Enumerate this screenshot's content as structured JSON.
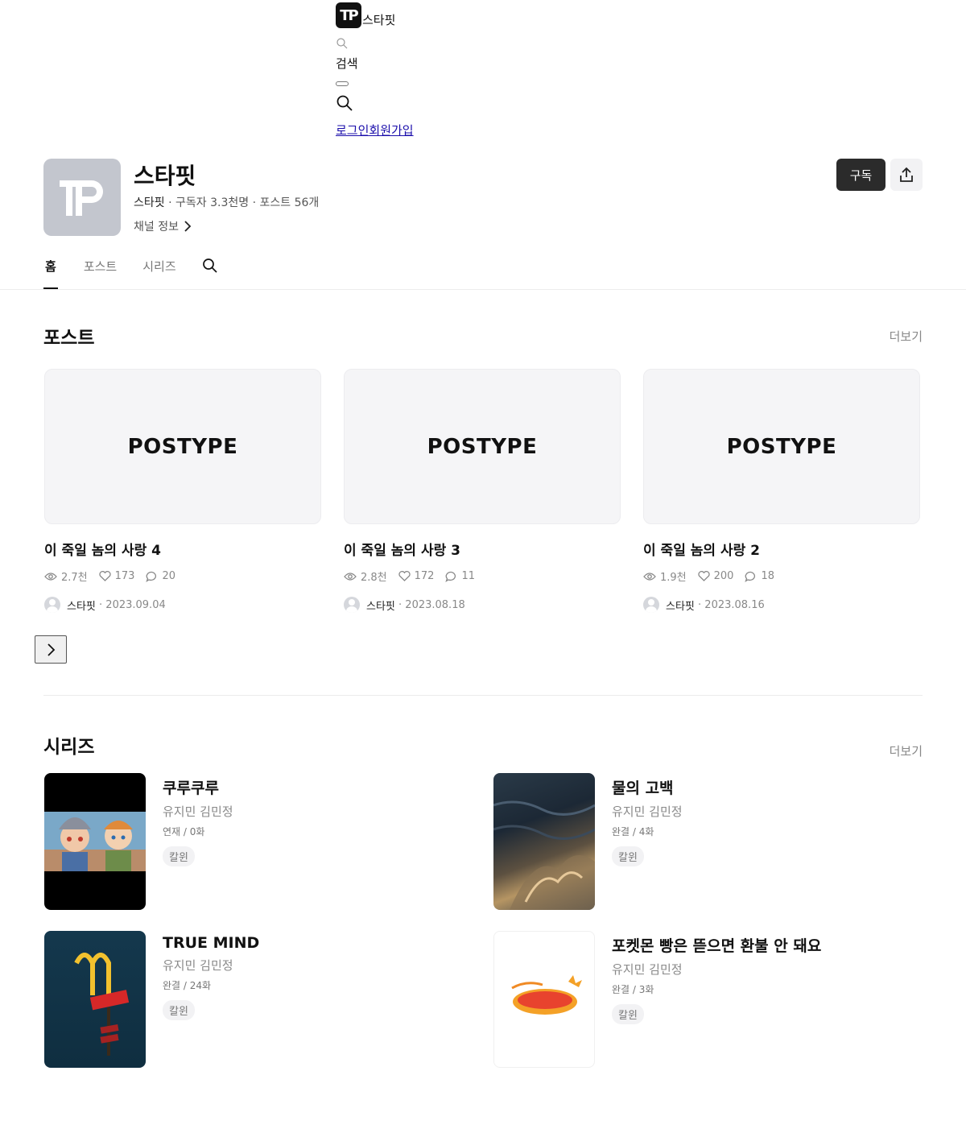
{
  "header": {
    "brand_name": "스타핏",
    "search_label": "검색",
    "login": "로그인",
    "signup": "회원가입"
  },
  "channel": {
    "title": "스타핏",
    "owner": "스타핏",
    "subscribers": "구독자 3.3천명",
    "posts_count": "포스트 56개",
    "info_label": "채널 정보",
    "subscribe_label": "구독"
  },
  "tabs": [
    {
      "label": "홈",
      "active": true
    },
    {
      "label": "포스트",
      "active": false
    },
    {
      "label": "시리즈",
      "active": false
    }
  ],
  "posts_section": {
    "title": "포스트",
    "more": "더보기",
    "items": [
      {
        "thumb_text": "POSTYPE",
        "title": "이 죽일 놈의 사랑 4",
        "views": "2.7천",
        "likes": "173",
        "comments": "20",
        "author": "스타핏",
        "date": "2023.09.04"
      },
      {
        "thumb_text": "POSTYPE",
        "title": "이 죽일 놈의 사랑 3",
        "views": "2.8천",
        "likes": "172",
        "comments": "11",
        "author": "스타핏",
        "date": "2023.08.18"
      },
      {
        "thumb_text": "POSTYPE",
        "title": "이 죽일 놈의 사랑 2",
        "views": "1.9천",
        "likes": "200",
        "comments": "18",
        "author": "스타핏",
        "date": "2023.08.16"
      }
    ]
  },
  "series_section": {
    "title": "시리즈",
    "more": "더보기",
    "items": [
      {
        "title": "쿠루쿠루",
        "author": "유지민 김민정",
        "status": "연재 / 0화",
        "tag": "칼윈"
      },
      {
        "title": "물의 고백",
        "author": "유지민 김민정",
        "status": "완결 / 4화",
        "tag": "칼윈"
      },
      {
        "title": "TRUE MIND",
        "author": "유지민 김민정",
        "status": "완결 / 24화",
        "tag": "칼윈"
      },
      {
        "title": "포켓몬 빵은 뜯으면 환불 안 돼요",
        "author": "유지민 김민정",
        "status": "완결 / 3화",
        "tag": "칼윈"
      }
    ]
  },
  "colors": {
    "subscribe_bg": "#2b2b2b",
    "avatar_bg": "#c3c6ce",
    "muted_text": "#888888"
  }
}
